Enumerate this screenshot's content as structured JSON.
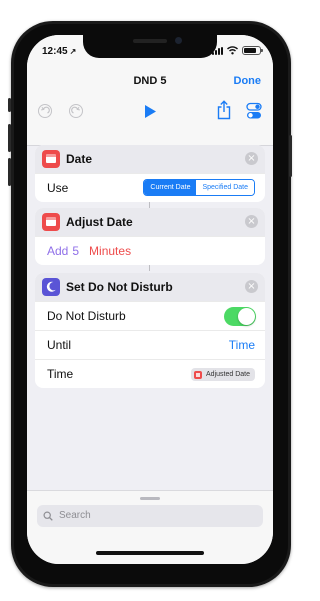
{
  "status_bar": {
    "time": "12:45",
    "location_glyph": "↗"
  },
  "nav": {
    "title": "DND 5",
    "done_label": "Done",
    "icons": [
      "undo-icon",
      "redo-icon",
      "play-icon",
      "share-icon",
      "settings-toggle-icon"
    ]
  },
  "actions": [
    {
      "title": "Date",
      "icon": "calendar-icon",
      "color": "#ee4b4b",
      "use_label": "Use",
      "segments": [
        "Current Date",
        "Specified Date"
      ],
      "selected_segment": "Current Date"
    },
    {
      "title": "Adjust Date",
      "icon": "calendar-icon",
      "color": "#ee4b4b",
      "operation": "Add",
      "amount": "5",
      "unit": "Minutes"
    },
    {
      "title": "Set Do Not Disturb",
      "icon": "moon-icon",
      "color": "#5a54d6",
      "dnd_label": "Do Not Disturb",
      "dnd_enabled": true,
      "until_label": "Until",
      "until_value": "Time",
      "time_label": "Time",
      "time_variable": "Adjusted Date"
    }
  ],
  "search": {
    "placeholder": "Search"
  },
  "colors": {
    "accent": "#1a7cf5",
    "toggle_on": "#4cd964",
    "date_red": "#ee4b4b",
    "dnd_purple": "#5a54d6"
  }
}
